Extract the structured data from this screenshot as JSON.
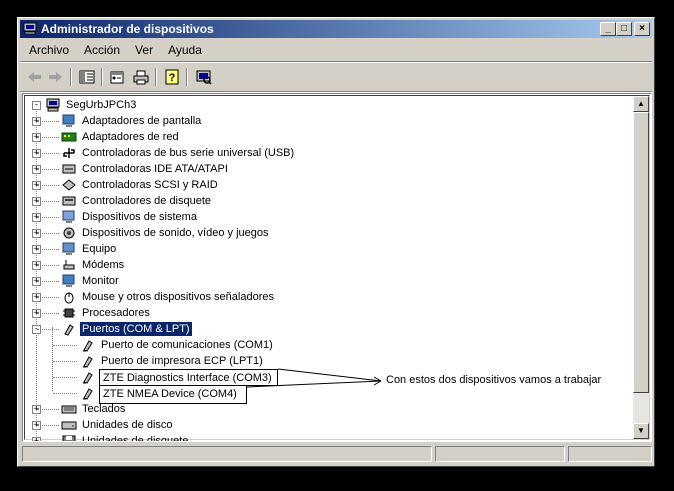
{
  "window": {
    "title": "Administrador de dispositivos"
  },
  "titlebar_buttons": {
    "minimize": "_",
    "maximize": "□",
    "close": "×"
  },
  "menu": [
    "Archivo",
    "Acción",
    "Ver",
    "Ayuda"
  ],
  "toolbar": {
    "back_icon": "arrow-left-icon",
    "forward_icon": "arrow-right-icon",
    "tree_icon": "console-tree-icon",
    "properties_icon": "properties-icon",
    "print_icon": "print-icon",
    "help_icon": "help-icon",
    "scan_icon": "scan-hardware-icon"
  },
  "tree": {
    "root": "SegUrbJPCh3",
    "categories": [
      "Adaptadores de pantalla",
      "Adaptadores de red",
      "Controladoras de bus serie universal (USB)",
      "Controladoras IDE ATA/ATAPI",
      "Controladoras SCSI y RAID",
      "Controladores de disquete",
      "Dispositivos de sistema",
      "Dispositivos de sonido, vídeo y juegos",
      "Equipo",
      "Módems",
      "Monitor",
      "Mouse y otros dispositivos señaladores",
      "Procesadores",
      "Puertos (COM & LPT)"
    ],
    "ports": [
      "Puerto de comunicaciones (COM1)",
      "Puerto de impresora ECP (LPT1)",
      "ZTE Diagnostics Interface (COM3)",
      "ZTE NMEA Device (COM4)"
    ],
    "after": [
      "Teclados",
      "Unidades de disco",
      "Unidades de disquete"
    ]
  },
  "annotation": "Con estos dos dispositivos vamos a trabajar",
  "colors": {
    "selection": "#0a246a",
    "title_start": "#0a246a",
    "title_end": "#a6caf0",
    "face": "#d4d0c8"
  }
}
